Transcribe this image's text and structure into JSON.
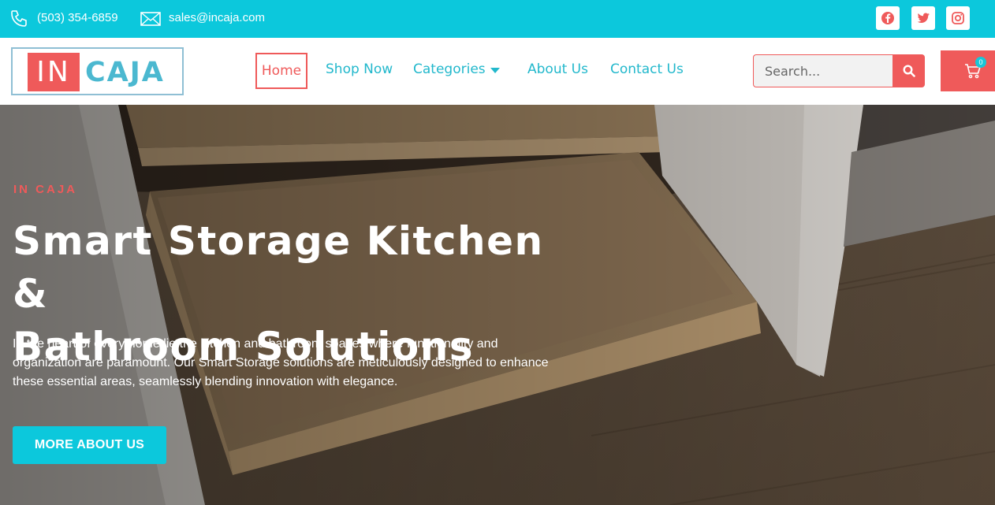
{
  "topbar": {
    "phone": "(503) 354-6859",
    "email": "sales@incaja.com",
    "social": [
      "facebook-icon",
      "twitter-icon",
      "instagram-icon"
    ]
  },
  "logo": {
    "part1": "IN",
    "part2": "CAJA"
  },
  "nav": {
    "home": "Home",
    "shop": "Shop Now",
    "categories": "Categories",
    "about": "About Us",
    "contact": "Contact Us"
  },
  "search": {
    "placeholder": "Search..."
  },
  "cart": {
    "count": "0"
  },
  "hero": {
    "eyebrow": "IN CAJA",
    "headline_line1": "Smart Storage Kitchen &",
    "headline_line2": "Bathroom Solutions",
    "description": "In the heart of every home lie the kitchen and bathroom spaces where functionality and organization are paramount. Our Smart Storage solutions are meticulously designed to enhance these essential areas, seamlessly blending innovation with elegance.",
    "cta": "MORE ABOUT US"
  },
  "colors": {
    "accent_cyan": "#0cc8dc",
    "accent_coral": "#ef5a5a",
    "nav_text": "#22b8cc"
  }
}
